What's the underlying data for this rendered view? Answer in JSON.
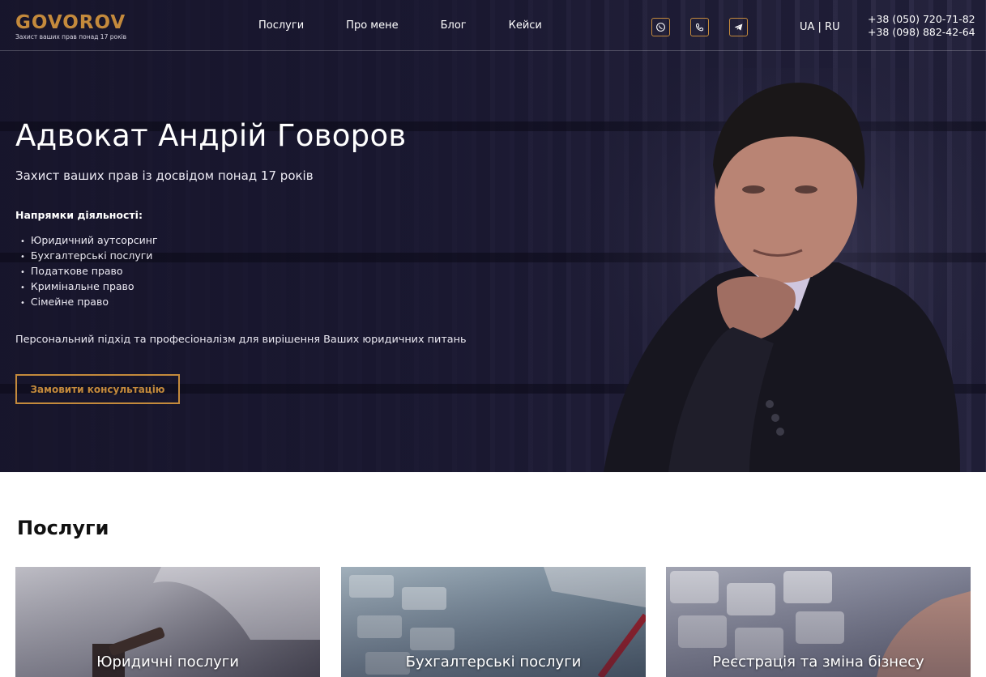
{
  "header": {
    "logo": "GOVOROV",
    "logo_tagline": "Захист ваших прав понад 17 років",
    "nav": [
      "Послуги",
      "Про мене",
      "Блог",
      "Кейси"
    ],
    "social_icons": [
      "whatsapp-icon",
      "viber-icon",
      "telegram-icon"
    ],
    "lang": "UA | RU",
    "phones": [
      "+38 (050) 720-71-82",
      "+38 (098) 882-42-64"
    ]
  },
  "hero": {
    "title": "Адвокат Андрій Говоров",
    "subtitle": "Захист ваших прав із досвідом понад 17 років",
    "directions_title": "Напрямки діяльності:",
    "directions": [
      "Юридичний аутсорсинг",
      "Бухгалтерські послуги",
      "Податкове право",
      "Кримінальне право",
      "Сімейне право"
    ],
    "tagline": "Персональний підхід та професіоналізм для вирішення Ваших юридичних питань",
    "cta": "Замовити консультацію"
  },
  "services": {
    "title": "Послуги",
    "cards": [
      "Юридичні послуги",
      "Бухгалтерські послуги",
      "Реєстрація та зміна бізнесу"
    ]
  },
  "colors": {
    "accent": "#c48a3c",
    "hero_bg": "#1d1c33",
    "text_light": "#ffffff",
    "text_dark": "#111111"
  }
}
